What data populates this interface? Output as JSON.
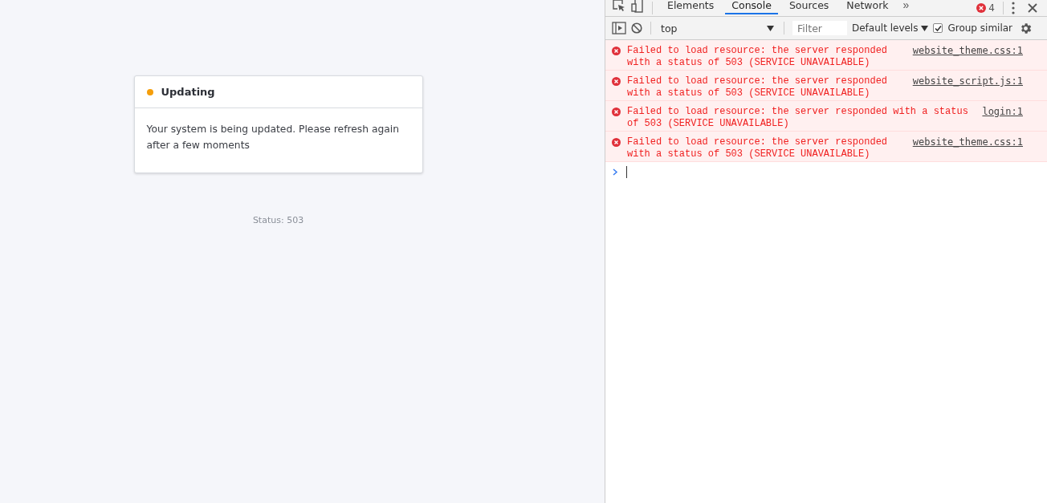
{
  "page": {
    "card": {
      "title": "Updating",
      "color": "#f59e0b",
      "message": "Your system is being updated. Please refresh again after a few moments"
    },
    "status": "Status: 503"
  },
  "devtools": {
    "tabs": [
      {
        "label": "Elements",
        "selected": false
      },
      {
        "label": "Console",
        "selected": true
      },
      {
        "label": "Sources",
        "selected": false
      },
      {
        "label": "Network",
        "selected": false
      }
    ],
    "overflow": "»",
    "error_count": "4",
    "toolbar": {
      "context": "top",
      "filter_placeholder": "Filter",
      "levels": "Default levels",
      "group_similar": {
        "label": "Group similar",
        "checked": true
      }
    },
    "messages": [
      {
        "kind": "error",
        "text": "Failed to load resource: the server responded with a status of 503 (SERVICE UNAVAILABLE)",
        "source": "website_theme.css:1"
      },
      {
        "kind": "error",
        "text": "Failed to load resource: the server responded with a status of 503 (SERVICE UNAVAILABLE)",
        "source": "website_script.js:1"
      },
      {
        "kind": "error",
        "text": "Failed to load resource: the server responded with a status of 503 (SERVICE UNAVAILABLE)",
        "source": "login:1"
      },
      {
        "kind": "error",
        "text": "Failed to load resource: the server responded with a status of 503 (SERVICE UNAVAILABLE)",
        "source": "website_theme.css:1"
      }
    ]
  }
}
